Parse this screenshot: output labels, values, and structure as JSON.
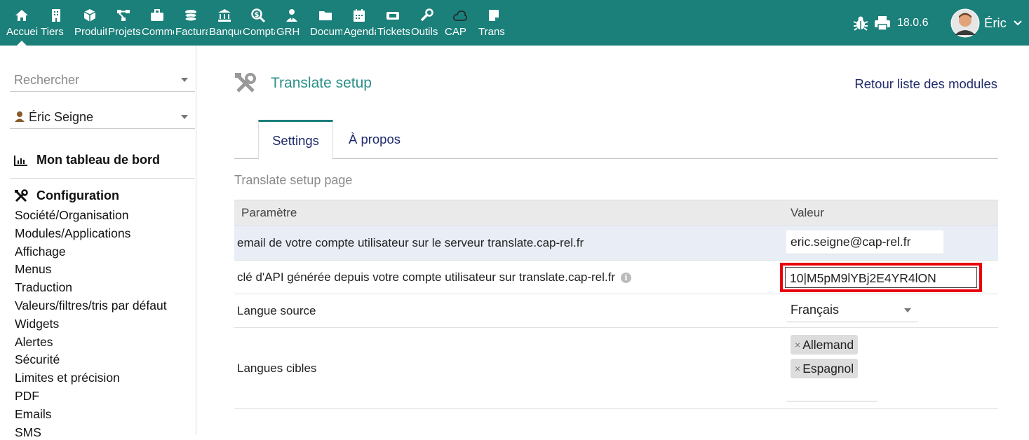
{
  "topbar": {
    "menu": [
      {
        "label": "Accueil",
        "icon": "home-icon"
      },
      {
        "label": "Tiers",
        "icon": "building-icon"
      },
      {
        "label": "Produits",
        "icon": "cube-icon"
      },
      {
        "label": "Projets",
        "icon": "project-icon"
      },
      {
        "label": "Commercial",
        "icon": "briefcase-icon"
      },
      {
        "label": "Facturation",
        "icon": "coins-icon"
      },
      {
        "label": "Banque",
        "icon": "bank-icon"
      },
      {
        "label": "Compta",
        "icon": "dollar-search-icon"
      },
      {
        "label": "GRH",
        "icon": "user-tie-icon"
      },
      {
        "label": "Documents",
        "icon": "folder-icon"
      },
      {
        "label": "Agenda",
        "icon": "calendar-icon"
      },
      {
        "label": "Tickets",
        "icon": "ticket-icon"
      },
      {
        "label": "Outils",
        "icon": "wrench-icon"
      },
      {
        "label": "CAP",
        "icon": "cloud-icon"
      },
      {
        "label": "Trans",
        "icon": "note-icon"
      }
    ],
    "version": "18.0.6",
    "user_name": "Éric"
  },
  "sidebar": {
    "search_placeholder": "Rechercher",
    "user_select": "Éric Seigne",
    "dashboard_label": "Mon tableau de bord",
    "config_label": "Configuration",
    "links": [
      "Société/Organisation",
      "Modules/Applications",
      "Affichage",
      "Menus",
      "Traduction",
      "Valeurs/filtres/tris par défaut",
      "Widgets",
      "Alertes",
      "Sécurité",
      "Limites et précision",
      "PDF",
      "Emails",
      "SMS"
    ]
  },
  "main": {
    "title": "Translate setup",
    "back_link": "Retour liste des modules",
    "tabs": [
      "Settings",
      "À propos"
    ],
    "subtitle": "Translate setup page",
    "table": {
      "col_param": "Paramètre",
      "col_value": "Valeur",
      "email_label": "email de votre compte utilisateur sur le serveur translate.cap-rel.fr",
      "email_value": "eric.seigne@cap-rel.fr",
      "api_label": "clé d'API générée depuis votre compte utilisateur sur translate.cap-rel.fr",
      "api_value": "10|M5pM9lYBj2E4YR4lON",
      "source_label": "Langue source",
      "source_value": "Français",
      "targets_label": "Langues cibles",
      "targets": [
        "Allemand",
        "Espagnol"
      ],
      "chip_remove": "×"
    }
  }
}
